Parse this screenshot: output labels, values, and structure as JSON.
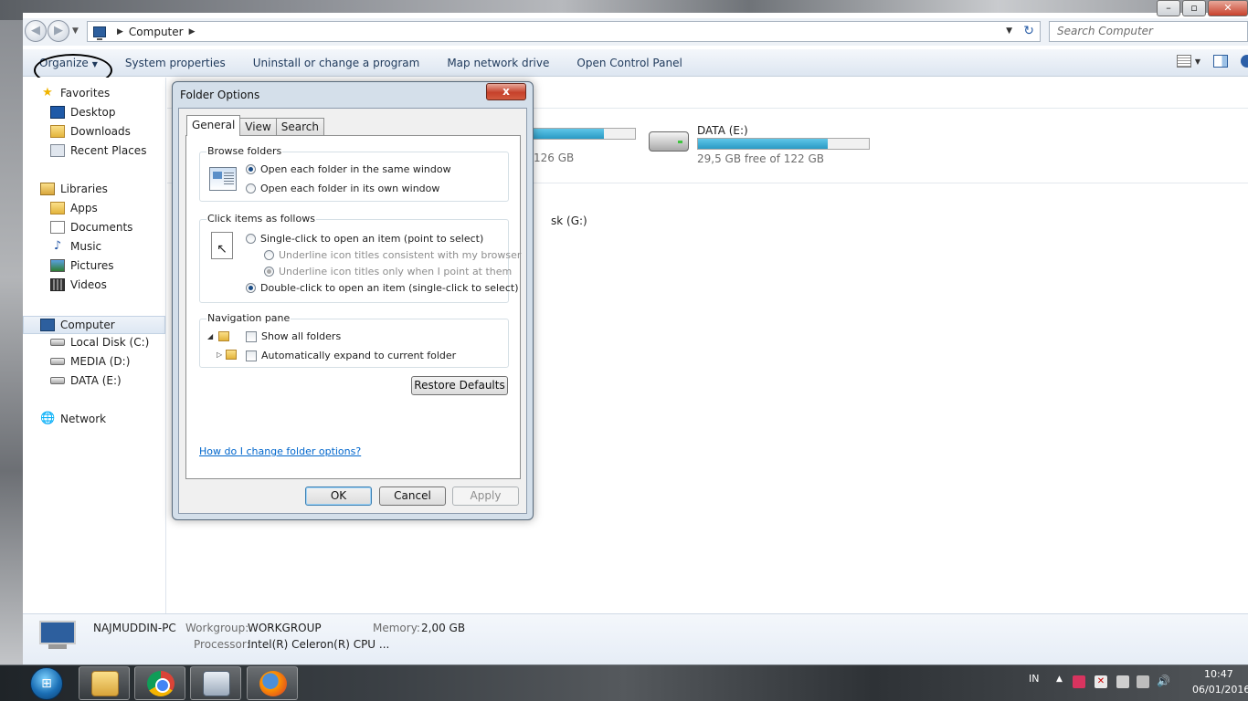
{
  "explorer": {
    "address": {
      "segment": "Computer",
      "search_placeholder": "Search Computer"
    },
    "toolbar": {
      "organize": "Organize",
      "items": [
        "System properties",
        "Uninstall or change a program",
        "Map network drive",
        "Open Control Panel"
      ]
    },
    "nav": {
      "favorites": {
        "label": "Favorites",
        "items": [
          "Desktop",
          "Downloads",
          "Recent Places"
        ]
      },
      "libraries": {
        "label": "Libraries",
        "items": [
          "Apps",
          "Documents",
          "Music",
          "Pictures",
          "Videos"
        ]
      },
      "computer": {
        "label": "Computer",
        "items": [
          "Local Disk (C:)",
          "MEDIA (D:)",
          "DATA (E:)"
        ]
      },
      "network": {
        "label": "Network"
      }
    },
    "content": {
      "partial_free": "126 GB",
      "partial_used_fraction": 0.7,
      "partial_drive_g": "sk (G:)",
      "data_drive": {
        "name": "DATA (E:)",
        "free": "29,5 GB free of 122 GB",
        "used_fraction": 0.76
      }
    },
    "details": {
      "name": "NAJMUDDIN-PC",
      "workgroup_label": "Workgroup:",
      "workgroup": "WORKGROUP",
      "memory_label": "Memory:",
      "memory": "2,00 GB",
      "processor_label": "Processor:",
      "processor": "Intel(R) Celeron(R) CPU ..."
    }
  },
  "dialog": {
    "title": "Folder Options",
    "close": "x",
    "tabs": [
      "General",
      "View",
      "Search"
    ],
    "browse": {
      "title": "Browse folders",
      "options": [
        "Open each folder in the same window",
        "Open each folder in its own window"
      ]
    },
    "click": {
      "title": "Click items as follows",
      "single": "Single-click to open an item (point to select)",
      "underline_browser": "Underline icon titles consistent with my browser",
      "underline_point": "Underline icon titles only when I point at them",
      "double": "Double-click to open an item (single-click to select)"
    },
    "nav": {
      "title": "Navigation pane",
      "show_all": "Show all folders",
      "auto_expand": "Automatically expand to current folder"
    },
    "restore": "Restore Defaults",
    "help_link": "How do I change folder options?",
    "ok": "OK",
    "cancel": "Cancel",
    "apply": "Apply"
  },
  "taskbar": {
    "lang": "IN",
    "time": "10:47",
    "date": "06/01/2016"
  }
}
